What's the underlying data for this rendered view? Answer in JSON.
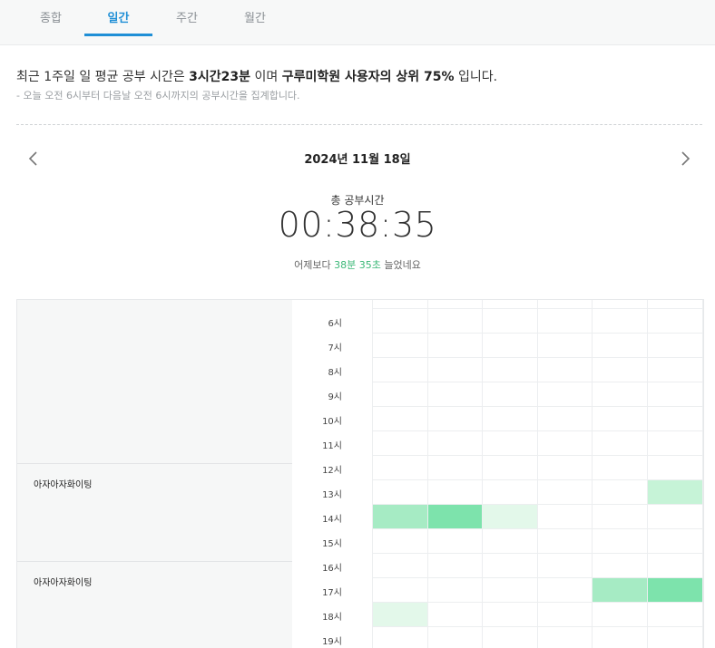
{
  "tabs": [
    {
      "label": "종합",
      "active": false
    },
    {
      "label": "일간",
      "active": true
    },
    {
      "label": "주간",
      "active": false
    },
    {
      "label": "월간",
      "active": false
    }
  ],
  "summary": {
    "prefix": "최근 1주일 일 평균 공부 시간은 ",
    "avg_time": "3시간23분",
    "middle": " 이며 ",
    "rank_text": "구루미학원 사용자의 상위 75%",
    "suffix": " 입니다.",
    "note": "- 오늘 오전 6시부터 다음날 오전 6시까지의 공부시간을 집계합니다."
  },
  "date_nav": {
    "date": "2024년 11월 18일",
    "prev_icon": "chevron-left-icon",
    "next_icon": "chevron-right-icon"
  },
  "total": {
    "label": "총 공부시간",
    "time": "00:38:35",
    "compare_prefix": "어제보다 ",
    "compare_value": "38분 35초",
    "compare_suffix": " 늘었네요"
  },
  "timeline": {
    "hours": [
      "6시",
      "7시",
      "8시",
      "9시",
      "10시",
      "11시",
      "12시",
      "13시",
      "14시",
      "15시",
      "16시",
      "17시",
      "18시",
      "19시"
    ],
    "columns_per_hour": 6,
    "subjects": [
      {
        "name": "아자아자화이팅",
        "start_hour_index": 7
      },
      {
        "name": "아자아자화이팅",
        "start_hour_index": 11
      }
    ],
    "colors": {
      "light": "#e3f8ea",
      "medium": "#a6ebc4",
      "strong": "#7de3ac",
      "soft": "#c6f3d7"
    },
    "filled_cells": [
      {
        "hour_index": 7,
        "col": 5,
        "level": "soft"
      },
      {
        "hour_index": 8,
        "col": 0,
        "level": "medium"
      },
      {
        "hour_index": 8,
        "col": 1,
        "level": "strong"
      },
      {
        "hour_index": 8,
        "col": 2,
        "level": "light"
      },
      {
        "hour_index": 11,
        "col": 4,
        "level": "medium"
      },
      {
        "hour_index": 11,
        "col": 5,
        "level": "strong"
      },
      {
        "hour_index": 12,
        "col": 0,
        "level": "light"
      }
    ]
  }
}
